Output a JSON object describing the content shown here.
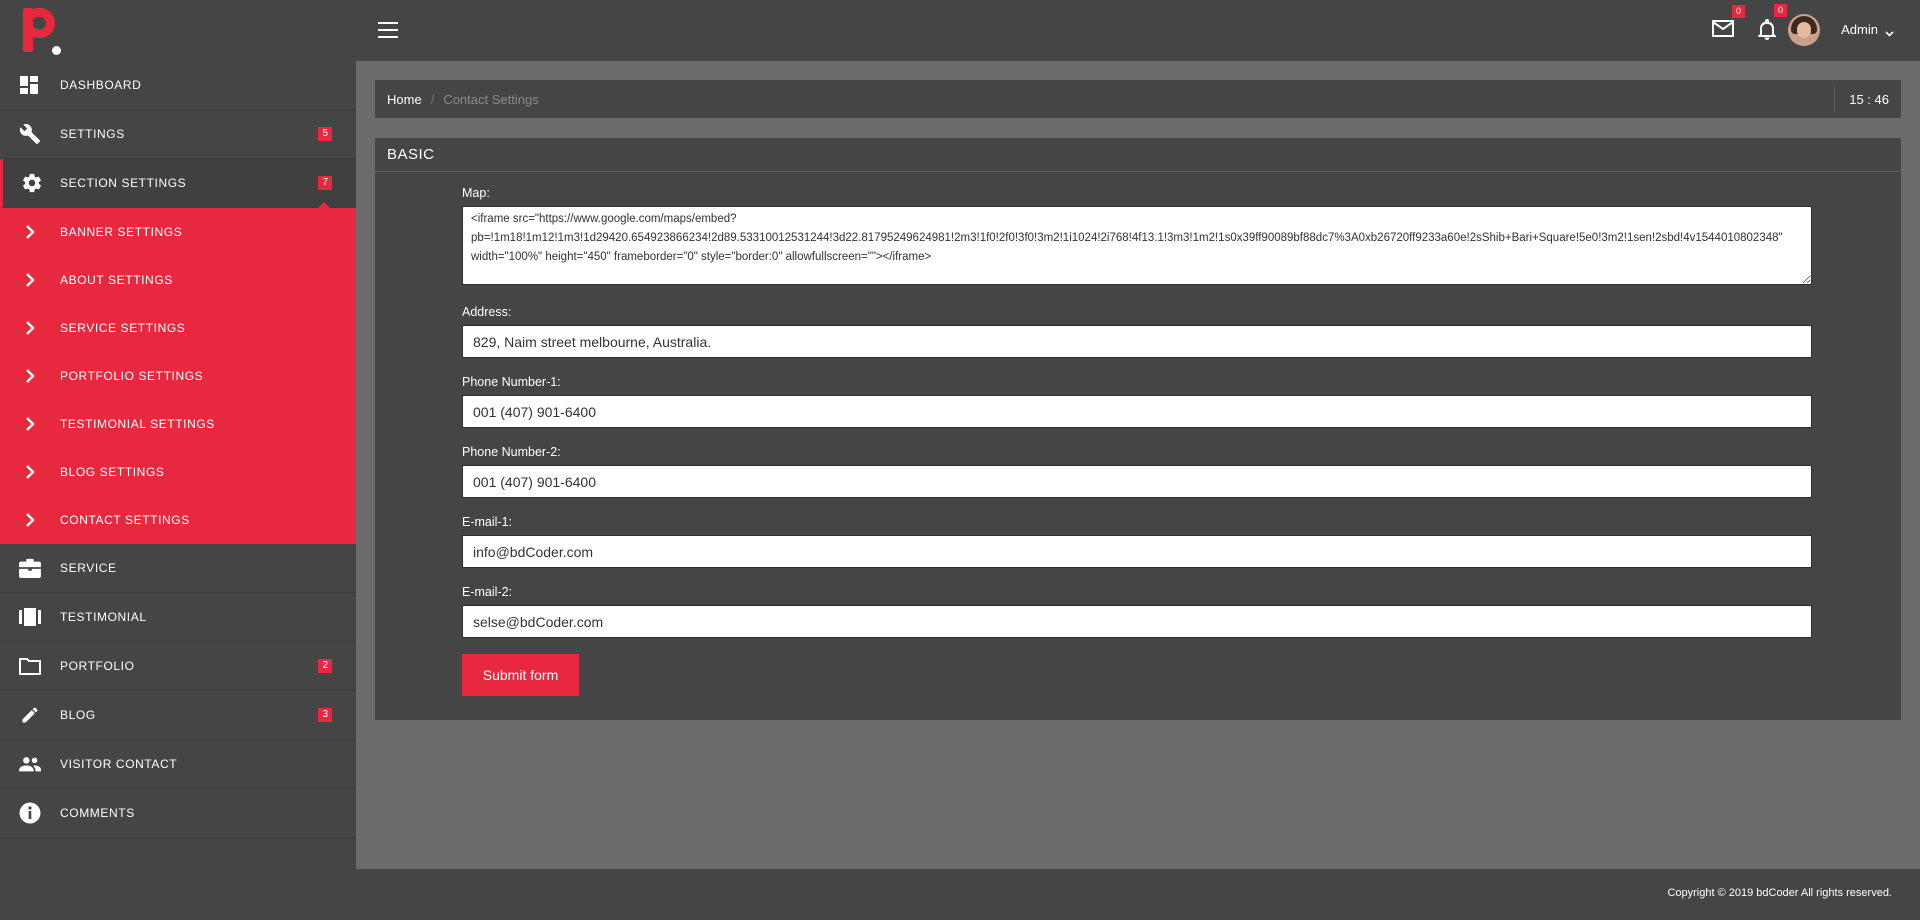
{
  "brand": {
    "accent": "#e8283f",
    "sidebar_bg": "#454545",
    "content_bg": "#6b6b6b"
  },
  "sidebar": {
    "items": [
      {
        "label": "DASHBOARD",
        "icon": "dashboard-icon"
      },
      {
        "label": "SETTINGS",
        "icon": "wrench-icon",
        "badge": "5"
      },
      {
        "label": "SECTION SETTINGS",
        "icon": "gear-icon",
        "badge": "7",
        "active": true
      },
      {
        "label": "SERVICE",
        "icon": "briefcase-icon"
      },
      {
        "label": "TESTIMONIAL",
        "icon": "carousel-icon"
      },
      {
        "label": "PORTFOLIO",
        "icon": "folder-icon",
        "badge": "2"
      },
      {
        "label": "BLOG",
        "icon": "pencil-icon",
        "badge": "3"
      },
      {
        "label": "VISITOR CONTACT",
        "icon": "people-icon"
      },
      {
        "label": "COMMENTS",
        "icon": "info-icon"
      }
    ],
    "submenu": [
      {
        "label": "BANNER SETTINGS"
      },
      {
        "label": "ABOUT SETTINGS"
      },
      {
        "label": "SERVICE SETTINGS"
      },
      {
        "label": "PORTFOLIO SETTINGS"
      },
      {
        "label": "TESTIMONIAL SETTINGS"
      },
      {
        "label": "BLOG SETTINGS"
      },
      {
        "label": "CONTACT SETTINGS"
      }
    ]
  },
  "header": {
    "mail_badge": "0",
    "notification_badge": "0",
    "user_name": "Admin"
  },
  "breadcrumb": {
    "home": "Home",
    "separator": "/",
    "current": "Contact Settings",
    "time": "15 : 46"
  },
  "panel": {
    "title": "BASIC",
    "fields": {
      "map": {
        "label": "Map:",
        "value": "<iframe src=\"https://www.google.com/maps/embed?pb=!1m18!1m12!1m3!1d29420.654923866234!2d89.53310012531244!3d22.81795249624981!2m3!1f0!2f0!3f0!3m2!1i1024!2i768!4f13.1!3m3!1m2!1s0x39ff90089bf88dc7%3A0xb26720ff9233a60e!2sShib+Bari+Square!5e0!3m2!1sen!2sbd!4v1544010802348\" width=\"100%\" height=\"450\" frameborder=\"0\" style=\"border:0\" allowfullscreen=\"\"></iframe>"
      },
      "address": {
        "label": "Address:",
        "value": "829, Naim street melbourne, Australia."
      },
      "phone1": {
        "label": "Phone Number-1:",
        "value": "001 (407) 901-6400"
      },
      "phone2": {
        "label": "Phone Number-2:",
        "value": "001 (407) 901-6400"
      },
      "email1": {
        "label": "E-mail-1:",
        "value": "info@bdCoder.com"
      },
      "email2": {
        "label": "E-mail-2:",
        "value": "selse@bdCoder.com"
      }
    },
    "submit_label": "Submit form"
  },
  "footer": {
    "copyright": "Copyright © 2019 bdCoder All rights reserved."
  }
}
